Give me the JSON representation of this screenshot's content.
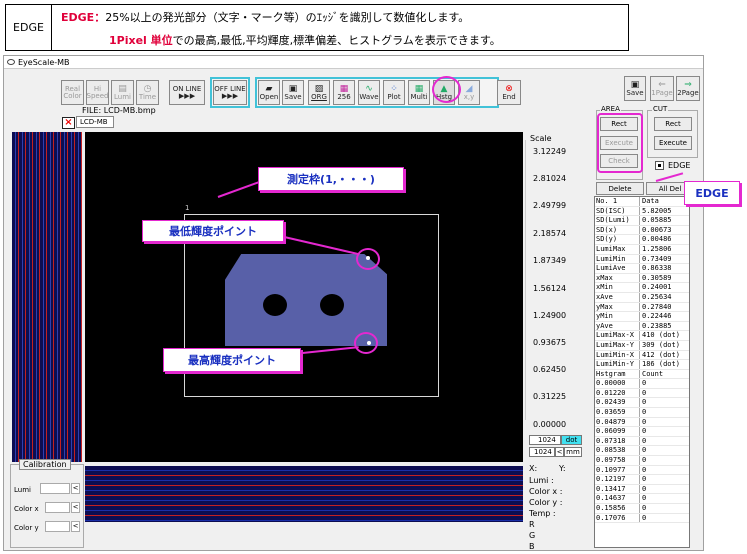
{
  "header": {
    "label": "EDGE",
    "line1_red": "EDGE：",
    "line1_rest": "25%以上の発光部分（文字・マーク等）のｴｯｼﾞを識別して数値化します。",
    "line2_red": "1Pixel 単位",
    "line2_rest": "での最高,最低,平均輝度,標準偏差、ヒストグラムを表示できます。"
  },
  "window": {
    "title": "EyeScale-MB"
  },
  "toolbar": {
    "real_color": [
      "Real",
      "Color"
    ],
    "hi_speed": [
      "Hi",
      "Speed"
    ],
    "lumi": "Lumi",
    "time": "Time",
    "online": [
      "ON LINE",
      "▶▶▶"
    ],
    "offline": [
      "OFF LINE",
      "▶▶▶"
    ],
    "open": "Open",
    "save": "Save",
    "org": "ORG",
    "n256": "256",
    "wave": "Wave",
    "plot": "Plot",
    "multi": "Multi",
    "hstg": "Hstg",
    "xy": "x,y",
    "end": "End",
    "save2": "Save",
    "page1": "1Page",
    "page2": "2Page"
  },
  "file": {
    "label": "FILE:   LCD-MB.bmp",
    "tab": "LCD-MB"
  },
  "measure": {
    "frame_no": "1"
  },
  "scale": {
    "title": "Scale",
    "values": [
      "3.12249",
      "2.81024",
      "2.49799",
      "2.18574",
      "1.87349",
      "1.56124",
      "1.24900",
      "0.93675",
      "0.62450",
      "0.31225",
      "0.00000"
    ]
  },
  "dims": {
    "w": "1024",
    "h": "1024",
    "unit_dot": "dot",
    "unit_mm": "mm",
    "arrow": "<"
  },
  "area": {
    "title": "AREA",
    "rect": "Rect",
    "execute": "Execute",
    "check": "Check"
  },
  "cut": {
    "title": "CUT",
    "rect": "Rect",
    "execute": "Execute"
  },
  "edge": {
    "label": "EDGE"
  },
  "list": {
    "delete": "Delete",
    "all_delete": "All Del"
  },
  "table": [
    [
      "No. 1",
      "Data"
    ],
    [
      "SD(ISC)",
      "5.82005"
    ],
    [
      "SD(Lumi)",
      "0.05885"
    ],
    [
      "SD(x)",
      "0.00673"
    ],
    [
      "SD(y)",
      "0.00486"
    ],
    [
      "LumiMax",
      "1.25806"
    ],
    [
      "LumiMin",
      "0.73409"
    ],
    [
      "LumiAve",
      "0.86338"
    ],
    [
      "xMax",
      "0.30589"
    ],
    [
      "xMin",
      "0.24001"
    ],
    [
      "xAve",
      "0.25634"
    ],
    [
      "yMax",
      "0.27840"
    ],
    [
      "yMin",
      "0.22446"
    ],
    [
      "yAve",
      "0.23885"
    ],
    [
      "LumiMax-X",
      "410 (dot)"
    ],
    [
      "LumiMax-Y",
      "309 (dot)"
    ],
    [
      "LumiMin-X",
      "412 (dot)"
    ],
    [
      "LumiMin-Y",
      "186 (dot)"
    ],
    [
      "Hstgram",
      "Count"
    ],
    [
      "0.00000",
      "0"
    ],
    [
      "0.01220",
      "0"
    ],
    [
      "0.02439",
      "0"
    ],
    [
      "0.03659",
      "0"
    ],
    [
      "0.04879",
      "0"
    ],
    [
      "0.06099",
      "0"
    ],
    [
      "0.07318",
      "0"
    ],
    [
      "0.08538",
      "0"
    ],
    [
      "0.09758",
      "0"
    ],
    [
      "0.10977",
      "0"
    ],
    [
      "0.12197",
      "0"
    ],
    [
      "0.13417",
      "0"
    ],
    [
      "0.14637",
      "0"
    ],
    [
      "0.15856",
      "0"
    ],
    [
      "0.17076",
      "0"
    ]
  ],
  "calibration": {
    "title": "Calibration",
    "lumi": "Lumi",
    "color_x": "Color x",
    "color_y": "Color y",
    "arrow": "<"
  },
  "readout": {
    "x": "X:",
    "y": "Y:",
    "lumi": "Lumi    :",
    "color_x": "Color x  :",
    "color_y": "Color y  :",
    "temp": "Temp     :",
    "r": "R",
    "g": "G",
    "b": "B"
  },
  "callouts": {
    "measure": "測定枠(1,・・・)",
    "min_point": "最低輝度ポイント",
    "max_point": "最高輝度ポイント",
    "edge": "EDGE"
  },
  "colors": {
    "highlight": "#e428d0",
    "accent_red": "#e0003a",
    "group_border": "#41c2d8",
    "callout_text": "#1a30c0"
  }
}
